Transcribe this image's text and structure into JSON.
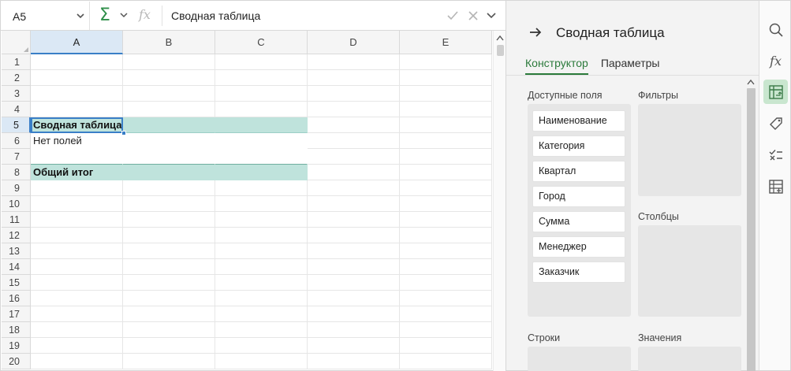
{
  "formula_bar": {
    "cell_ref": "A5",
    "formula": "Сводная таблица",
    "icons": [
      "chevron-down-icon",
      "sigma-icon",
      "fx-icon",
      "check-icon",
      "close-icon"
    ]
  },
  "sheet": {
    "columns": [
      "A",
      "B",
      "C",
      "D",
      "E"
    ],
    "selected_column": "A",
    "rows": [
      "1",
      "2",
      "3",
      "4",
      "5",
      "6",
      "7",
      "8",
      "9",
      "10",
      "11",
      "12",
      "13",
      "14",
      "15",
      "16",
      "17",
      "18",
      "19",
      "20"
    ],
    "selected_row": "5",
    "cells": {
      "A5": "Сводная таблица",
      "A6": "Нет полей",
      "A8": "Общий итог"
    },
    "colors": {
      "pivot_band": "#bfe3dc",
      "selection": "#3a7fc7"
    }
  },
  "panel": {
    "title": "Сводная таблица",
    "tabs": [
      {
        "label": "Конструктор",
        "active": true
      },
      {
        "label": "Параметры",
        "active": false
      }
    ],
    "available_fields_label": "Доступные поля",
    "fields": [
      "Наименование",
      "Категория",
      "Квартал",
      "Город",
      "Сумма",
      "Менеджер",
      "Заказчик"
    ],
    "filters_label": "Фильтры",
    "columns_label": "Столбцы",
    "rows_label": "Строки",
    "values_label": "Значения",
    "accent_color": "#2b7a3b"
  },
  "rail": {
    "icons": [
      "search-icon",
      "function-icon",
      "pivot-table-icon",
      "tag-icon",
      "data-validation-icon",
      "table-settings-icon"
    ],
    "active": "pivot-table-icon"
  }
}
